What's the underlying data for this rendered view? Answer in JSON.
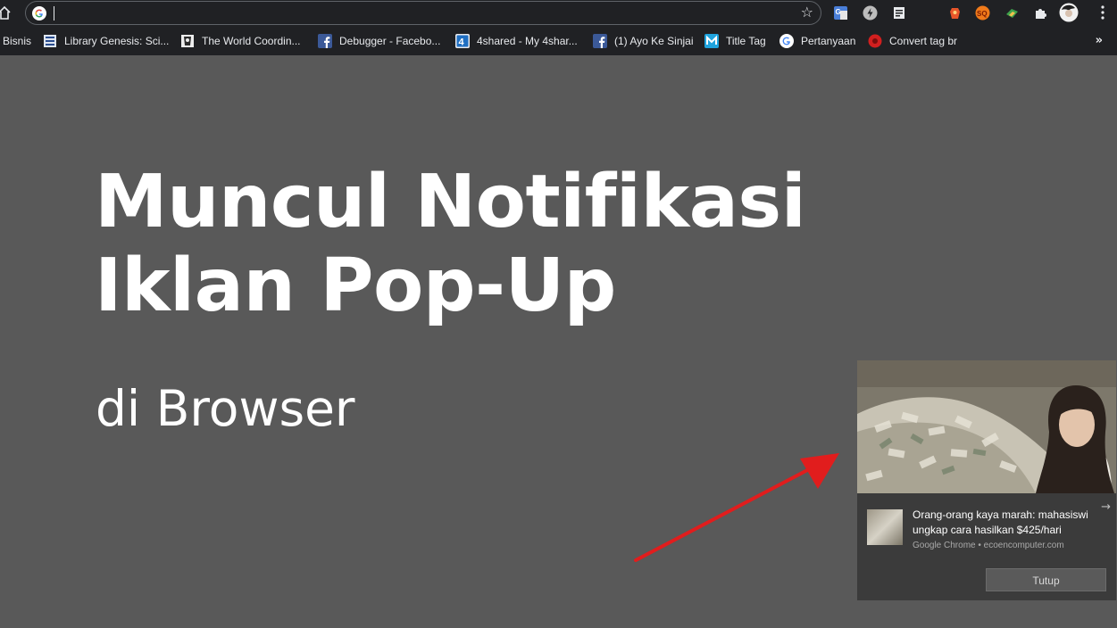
{
  "toolbar": {
    "address_value": "",
    "icons": [
      "home-icon",
      "google-icon",
      "star-icon",
      "translate-icon",
      "speed-icon",
      "reader-icon",
      "extension-orange-icon",
      "seo-quake-icon",
      "extension-green-icon",
      "puzzle-icon",
      "profile-avatar",
      "menu-icon"
    ]
  },
  "bookmarks": {
    "items": [
      {
        "label": "Bisnis",
        "icon": "none"
      },
      {
        "label": "Library Genesis: Sci...",
        "icon": "library-icon"
      },
      {
        "label": "The World Coordin...",
        "icon": "world-icon"
      },
      {
        "label": "Debugger - Facebo...",
        "icon": "facebook-icon"
      },
      {
        "label": "4shared - My 4shar...",
        "icon": "4shared-icon"
      },
      {
        "label": "(1) Ayo Ke Sinjai",
        "icon": "facebook-icon"
      },
      {
        "label": "Title Tag",
        "icon": "moz-icon"
      },
      {
        "label": "Pertanyaan",
        "icon": "google-icon"
      },
      {
        "label": "Convert tag br",
        "icon": "red-icon"
      }
    ],
    "more": "»"
  },
  "content": {
    "headline_line1": "Muncul Notifikasi",
    "headline_line2": "Iklan Pop-Up",
    "subline": "di Browser"
  },
  "notification": {
    "title": "Orang-orang kaya marah: mahasiswi ungkap cara hasilkan $425/hari",
    "source": "Google Chrome • ecoencomputer.com",
    "close_button": "Tutup",
    "arrow": "→"
  },
  "colors": {
    "background": "#595959",
    "toolbar": "#202124",
    "arrow": "#e11d1d",
    "notification_bg": "#3b3b3b"
  }
}
